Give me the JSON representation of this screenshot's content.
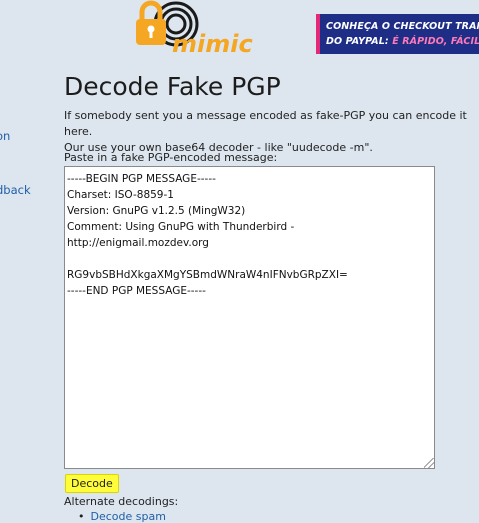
{
  "sidebar": {
    "link_1": "on",
    "link_2": "dback"
  },
  "logo": {
    "text": "mimic",
    "colors": {
      "orange": "#f5a623",
      "black": "#1a1a1a"
    }
  },
  "ad": {
    "line1": "CONHEÇA O CHECKOUT TRANSPAREN",
    "line2_prefix": "DO PAYPAL: ",
    "line2_highlight": "É RÁPIDO, FÁCIL E SEGUR"
  },
  "page": {
    "title": "Decode Fake PGP",
    "intro_line1": "If somebody sent you a message encoded as fake-PGP you can encode it here.",
    "intro_line2": "Our use your own base64 decoder - like \"uudecode -m\".",
    "paste_label": "Paste in a fake PGP-encoded message:",
    "message": "-----BEGIN PGP MESSAGE-----\nCharset: ISO-8859-1\nVersion: GnuPG v1.2.5 (MingW32)\nComment: Using GnuPG with Thunderbird -\nhttp://enigmail.mozdev.org\n\nRG9vbSBHdXkgaXMgYSBmdWNraW4nIFNvbGRpZXI=\n-----END PGP MESSAGE-----\n",
    "decode_button": "Decode",
    "alternate_label": "Alternate decodings:",
    "alternate_items": [
      "Decode spam"
    ]
  },
  "colors": {
    "background": "#dde6ee",
    "link": "#1f5fa8",
    "button_highlight": "#fffd3a",
    "ad_bg": "#1e2d86"
  }
}
